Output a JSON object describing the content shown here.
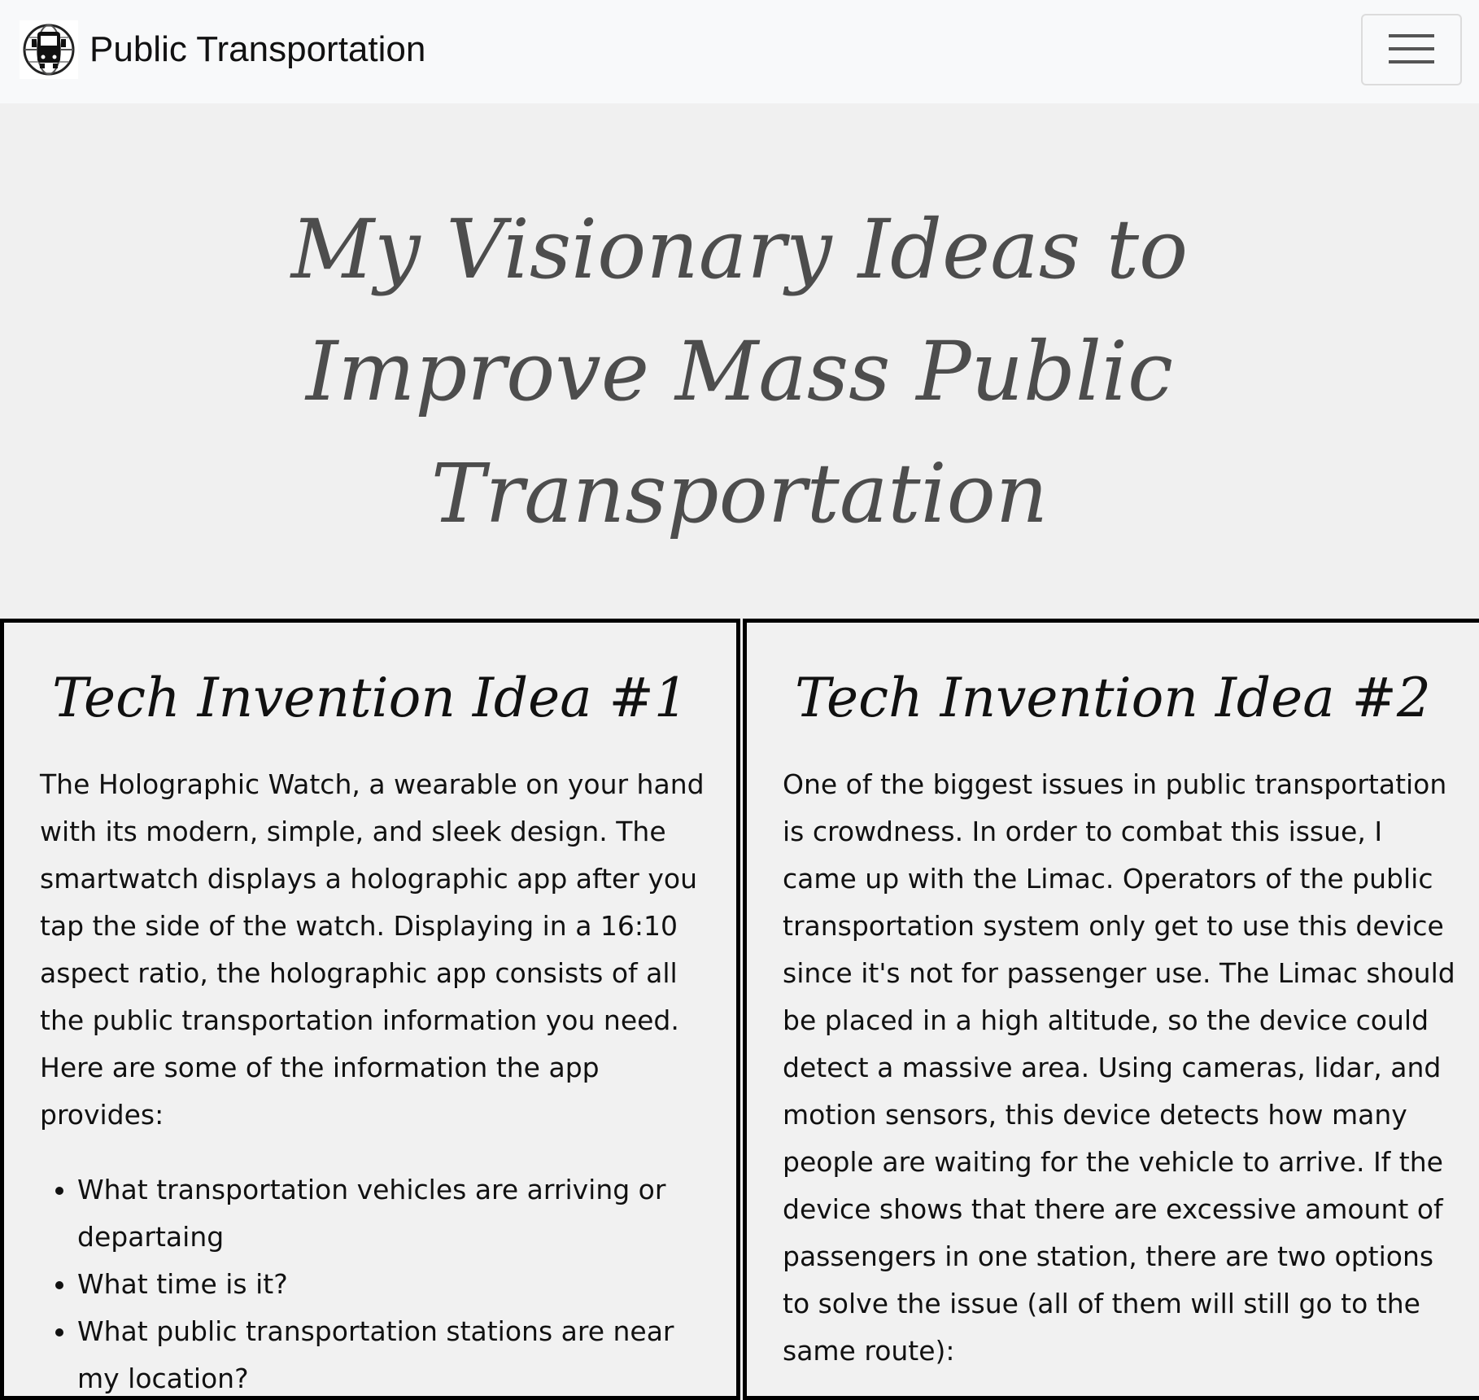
{
  "navbar": {
    "brand": "Public Transportation",
    "logo_icon": "bus-globe-icon",
    "menu_icon": "hamburger-menu-icon"
  },
  "hero": {
    "title": "My Visionary Ideas to Improve Mass Public Transportation"
  },
  "ideas": [
    {
      "title": "Tech Invention Idea #1",
      "body": "The Holographic Watch, a wearable on your hand with its modern, simple, and sleek design. The smartwatch displays a holographic app after you tap the side of the watch. Displaying in a 16:10 aspect ratio, the holographic app consists of all the public transportation information you need. Here are some of the information the app provides:",
      "bullets": [
        "What transportation vehicles are arriving or departaing",
        "What time is it?",
        "What public transportation stations are near my location?"
      ]
    },
    {
      "title": "Tech Invention Idea #2",
      "body": "One of the biggest issues in public transportation is crowdness. In order to combat this issue, I came up with the Limac. Operators of the public transportation system only get to use this device since it's not for passenger use. The Limac should be placed in a high altitude, so the device could detect a massive area. Using cameras, lidar, and motion sensors, this device detects how many people are waiting for the vehicle to arrive. If the device shows that there are excessive amount of passengers in one station, there are two options to solve the issue (all of them will still go to the same route):"
    }
  ]
}
